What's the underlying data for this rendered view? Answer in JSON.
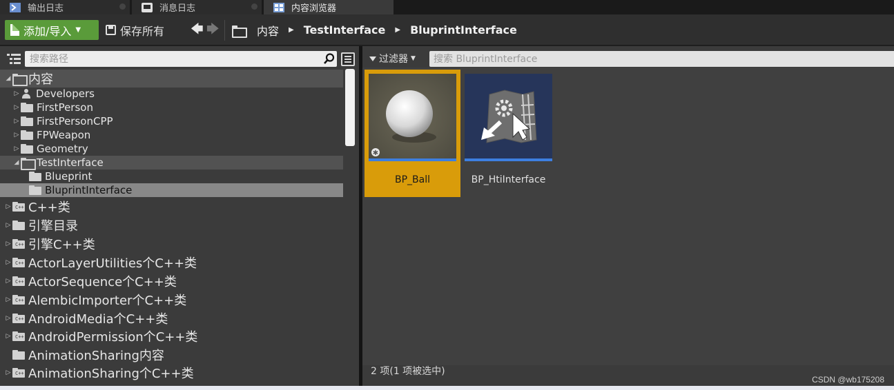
{
  "tabs": [
    {
      "label": "输出日志",
      "icon": "output-log-icon"
    },
    {
      "label": "消息日志",
      "icon": "message-log-icon"
    },
    {
      "label": "内容浏览器",
      "icon": "content-browser-icon",
      "active": true
    }
  ],
  "toolbar": {
    "add_import_label": "添加/导入",
    "save_all_label": "保存所有",
    "breadcrumbs": [
      "内容",
      "TestInterface",
      "BluprintInterface"
    ]
  },
  "sources": {
    "search_placeholder": "搜索路径",
    "tree": [
      {
        "label": "内容",
        "level": 0,
        "expanded": true,
        "style": "big",
        "selected_bg": true
      },
      {
        "label": "Developers",
        "level": 1,
        "icon": "person"
      },
      {
        "label": "FirstPerson",
        "level": 1
      },
      {
        "label": "FirstPersonCPP",
        "level": 1
      },
      {
        "label": "FPWeapon",
        "level": 1
      },
      {
        "label": "Geometry",
        "level": 1
      },
      {
        "label": "TestInterface",
        "level": 1,
        "expanded": true,
        "highlight": true
      },
      {
        "label": "Blueprint",
        "level": 2
      },
      {
        "label": "BluprintInterface",
        "level": 2,
        "selected": true
      },
      {
        "label": "C++类",
        "level": 0,
        "cpp": true
      },
      {
        "label": "引擎目录",
        "level": 0
      },
      {
        "label": "引擎C++类",
        "level": 0,
        "cpp": true
      },
      {
        "label": "ActorLayerUtilities个C++类",
        "level": 0,
        "cpp": true
      },
      {
        "label": "ActorSequence个C++类",
        "level": 0,
        "cpp": true
      },
      {
        "label": "AlembicImporter个C++类",
        "level": 0,
        "cpp": true
      },
      {
        "label": "AndroidMedia个C++类",
        "level": 0,
        "cpp": true
      },
      {
        "label": "AndroidPermission个C++类",
        "level": 0,
        "cpp": true
      },
      {
        "label": "AnimationSharing内容",
        "level": 0,
        "no_arrow": true
      },
      {
        "label": "AnimationSharing个C++类",
        "level": 0,
        "cpp": true
      }
    ]
  },
  "assets": {
    "filter_label": "过滤器",
    "search_placeholder": "搜索 BluprintInterface",
    "items": [
      {
        "name": "BP_Ball",
        "selected": true,
        "thumb": "sphere-thumbnail"
      },
      {
        "name": "BP_HtiInterface",
        "selected": false,
        "thumb": "blueprint-interface-thumbnail"
      }
    ],
    "status": "2 项(1 项被选中)"
  },
  "watermark": "CSDN @wb175208",
  "colors": {
    "accent_green": "#5a9b3a",
    "selection_orange": "#d99c0a",
    "asset_blue_bar": "#3d7fe0"
  }
}
